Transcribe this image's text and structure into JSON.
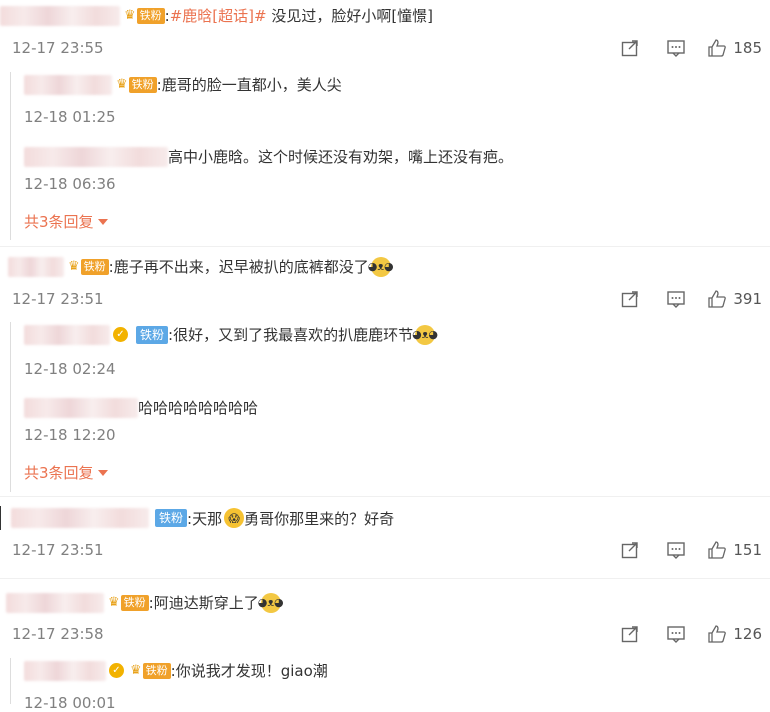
{
  "badges": {
    "fan": "铁粉",
    "crown": "♛",
    "verified": "✓"
  },
  "actions": {
    "share_icon": "share-icon",
    "comment_icon": "comment-icon",
    "like_icon": "thumbs-up-icon"
  },
  "comments": [
    {
      "text_prefix": ":",
      "topic": "#鹿晗[超话]#",
      "text": " 没见过，脸好小啊[憧憬]",
      "time": "12-17 23:55",
      "likes": "185",
      "replies": [
        {
          "text": ":鹿哥的脸一直都小，美人尖",
          "time": "12-18 01:25"
        },
        {
          "text": "高中小鹿晗。这个时候还没有劝架，嘴上还没有疤。",
          "time": "12-18 06:36"
        }
      ],
      "more": "共3条回复"
    },
    {
      "text": ":鹿子再不出来，迟早被扒的底裤都没了",
      "time": "12-17 23:51",
      "likes": "391",
      "replies": [
        {
          "text": ":很好，又到了我最喜欢的扒鹿鹿环节",
          "time": "12-18 02:24"
        },
        {
          "text": "哈哈哈哈哈哈哈哈",
          "time": "12-18 12:20"
        }
      ],
      "more": "共3条回复"
    },
    {
      "text_a": ":天那",
      "text_b": "勇哥你那里来的？好奇",
      "time": "12-17 23:51",
      "likes": "151"
    },
    {
      "text": ":阿迪达斯穿上了",
      "time": "12-17 23:58",
      "likes": "126",
      "replies": [
        {
          "text": ":你说我才发现！giao潮",
          "time": "12-18 00:01"
        }
      ]
    }
  ]
}
